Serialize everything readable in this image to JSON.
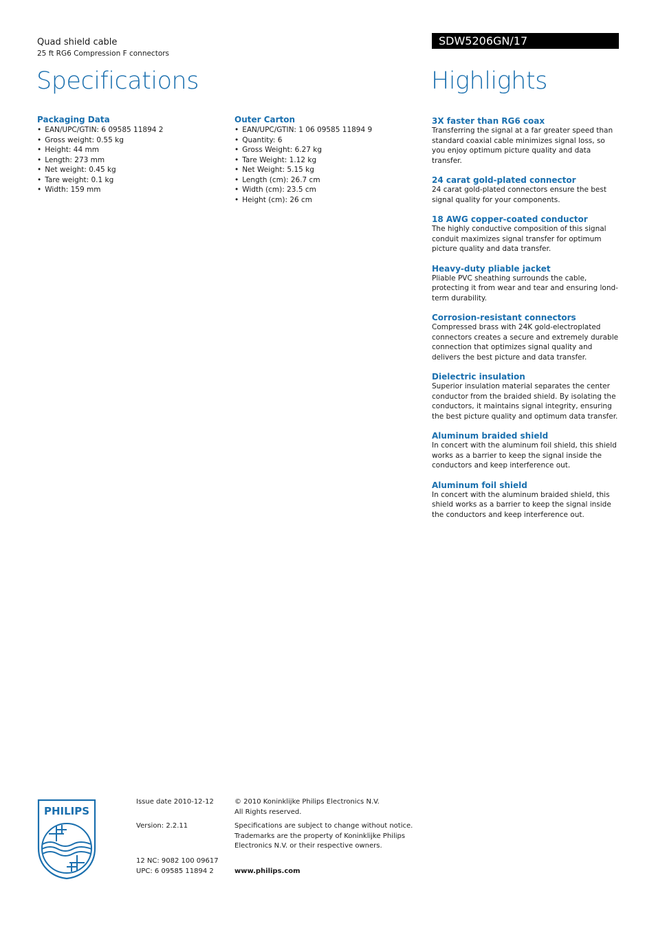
{
  "header": {
    "product_name": "Quad shield cable",
    "product_subtitle": "25 ft RG6 Compression F connectors",
    "model_number": "SDW5206GN/17"
  },
  "specifications": {
    "title": "Specifications",
    "sections": [
      {
        "heading": "Packaging Data",
        "items": [
          "EAN/UPC/GTIN: 6 09585 11894 2",
          "Gross weight: 0.55 kg",
          "Height: 44 mm",
          "Length: 273 mm",
          "Net weight: 0.45 kg",
          "Tare weight: 0.1 kg",
          "Width: 159 mm"
        ]
      },
      {
        "heading": "Outer Carton",
        "items": [
          "EAN/UPC/GTIN: 1 06 09585 11894 9",
          "Quantity: 6",
          "Gross Weight: 6.27 kg",
          "Tare Weight: 1.12 kg",
          "Net Weight: 5.15 kg",
          "Length (cm): 26.7 cm",
          "Width (cm): 23.5 cm",
          "Height (cm): 26 cm"
        ]
      }
    ]
  },
  "highlights": {
    "title": "Highlights",
    "items": [
      {
        "heading": "3X faster than RG6 coax",
        "body": "Transferring the signal at a far greater speed than standard coaxial cable minimizes signal loss, so you enjoy optimum picture quality and data transfer."
      },
      {
        "heading": "24 carat gold-plated connector",
        "body": "24 carat gold-plated connectors ensure the best signal quality for your components."
      },
      {
        "heading": "18 AWG copper-coated conductor",
        "body": "The highly conductive composition of this signal conduit maximizes signal transfer for optimum picture quality and data transfer."
      },
      {
        "heading": "Heavy-duty pliable jacket",
        "body": "Pliable PVC sheathing surrounds the cable, protecting it from wear and tear and ensuring lond-term durability."
      },
      {
        "heading": "Corrosion-resistant connectors",
        "body": "Compressed brass with 24K gold-electroplated connectors creates a secure and extremely durable connection that optimizes signal quality and delivers the best picture and data transfer."
      },
      {
        "heading": "Dielectric insulation",
        "body": "Superior insulation material separates the center conductor from the braided shield. By isolating the conductors, it maintains signal integrity, ensuring the best picture quality and optimum data transfer."
      },
      {
        "heading": "Aluminum braided shield",
        "body": "In concert with the aluminum foil shield, this shield works as a barrier to keep the signal inside the conductors and keep interference out."
      },
      {
        "heading": "Aluminum foil shield",
        "body": "In concert with the aluminum braided shield, this shield works as a barrier to keep the signal inside the conductors and keep interference out."
      }
    ]
  },
  "footer": {
    "logo_text": "PHILIPS",
    "logo_icon": "philips-shield-logo",
    "issue_date": "Issue date 2010-12-12",
    "version": "Version: 2.2.11",
    "nc": "12 NC: 9082 100 09617",
    "upc": "UPC: 6 09585 11894 2",
    "copyright_line1": "© 2010 Koninklijke Philips Electronics N.V.",
    "copyright_line2": "All Rights reserved.",
    "notice_line1": "Specifications are subject to change without notice.",
    "notice_line2": "Trademarks are the property of Koninklijke Philips",
    "notice_line3": "Electronics N.V. or their respective owners.",
    "website": "www.philips.com"
  },
  "colors": {
    "brand_blue": "#1a6fae",
    "model_bar_bg": "#000000",
    "text": "#1a1a1a"
  }
}
